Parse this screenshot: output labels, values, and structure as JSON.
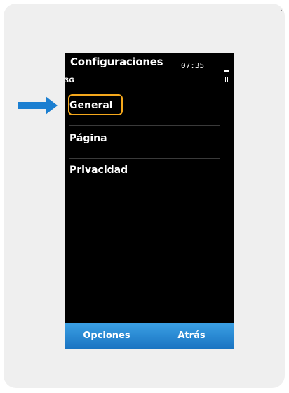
{
  "header": {
    "title": "Configuraciones",
    "time": "07:35",
    "network": "3G"
  },
  "menu": {
    "items": [
      {
        "label": "General",
        "highlighted": true
      },
      {
        "label": "Página",
        "highlighted": false
      },
      {
        "label": "Privacidad",
        "highlighted": false
      }
    ]
  },
  "softkeys": {
    "left_label": "Opciones",
    "right_label": "Atrás"
  },
  "annotation": {
    "arrow_icon": "arrow-right-icon",
    "arrow_color": "#1b7fd1",
    "highlight_color": "#f5a81c"
  },
  "colors": {
    "screen_bg": "#000000",
    "softkey_bar": "#2a8ad6",
    "card_bg": "#efefef"
  }
}
